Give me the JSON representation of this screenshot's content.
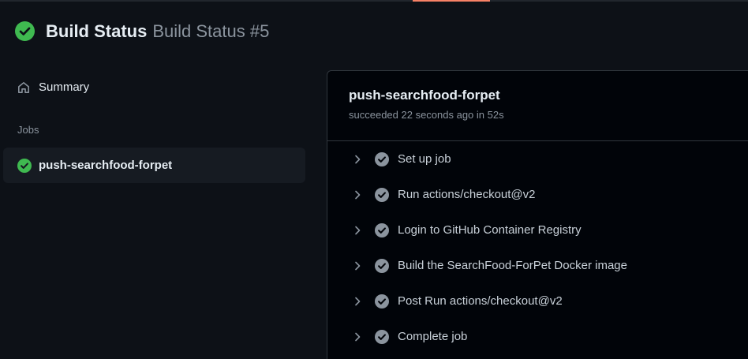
{
  "header": {
    "title": "Build Status",
    "run_label": "Build Status #5"
  },
  "sidebar": {
    "summary_label": "Summary",
    "jobs_heading": "Jobs",
    "jobs": [
      {
        "name": "push-searchfood-forpet"
      }
    ]
  },
  "job": {
    "title": "push-searchfood-forpet",
    "meta": "succeeded 22 seconds ago in 52s",
    "steps": [
      {
        "label": "Set up job"
      },
      {
        "label": "Run actions/checkout@v2"
      },
      {
        "label": "Login to GitHub Container Registry"
      },
      {
        "label": "Build the SearchFood-ForPet Docker image"
      },
      {
        "label": "Post Run actions/checkout@v2"
      },
      {
        "label": "Complete job"
      }
    ]
  },
  "colors": {
    "success": "#3fb950",
    "step_check": "#8b949e",
    "accent": "#f78166"
  },
  "icons": {
    "status": "check-circle-icon",
    "home": "home-icon",
    "chevron": "chevron-right-icon"
  }
}
